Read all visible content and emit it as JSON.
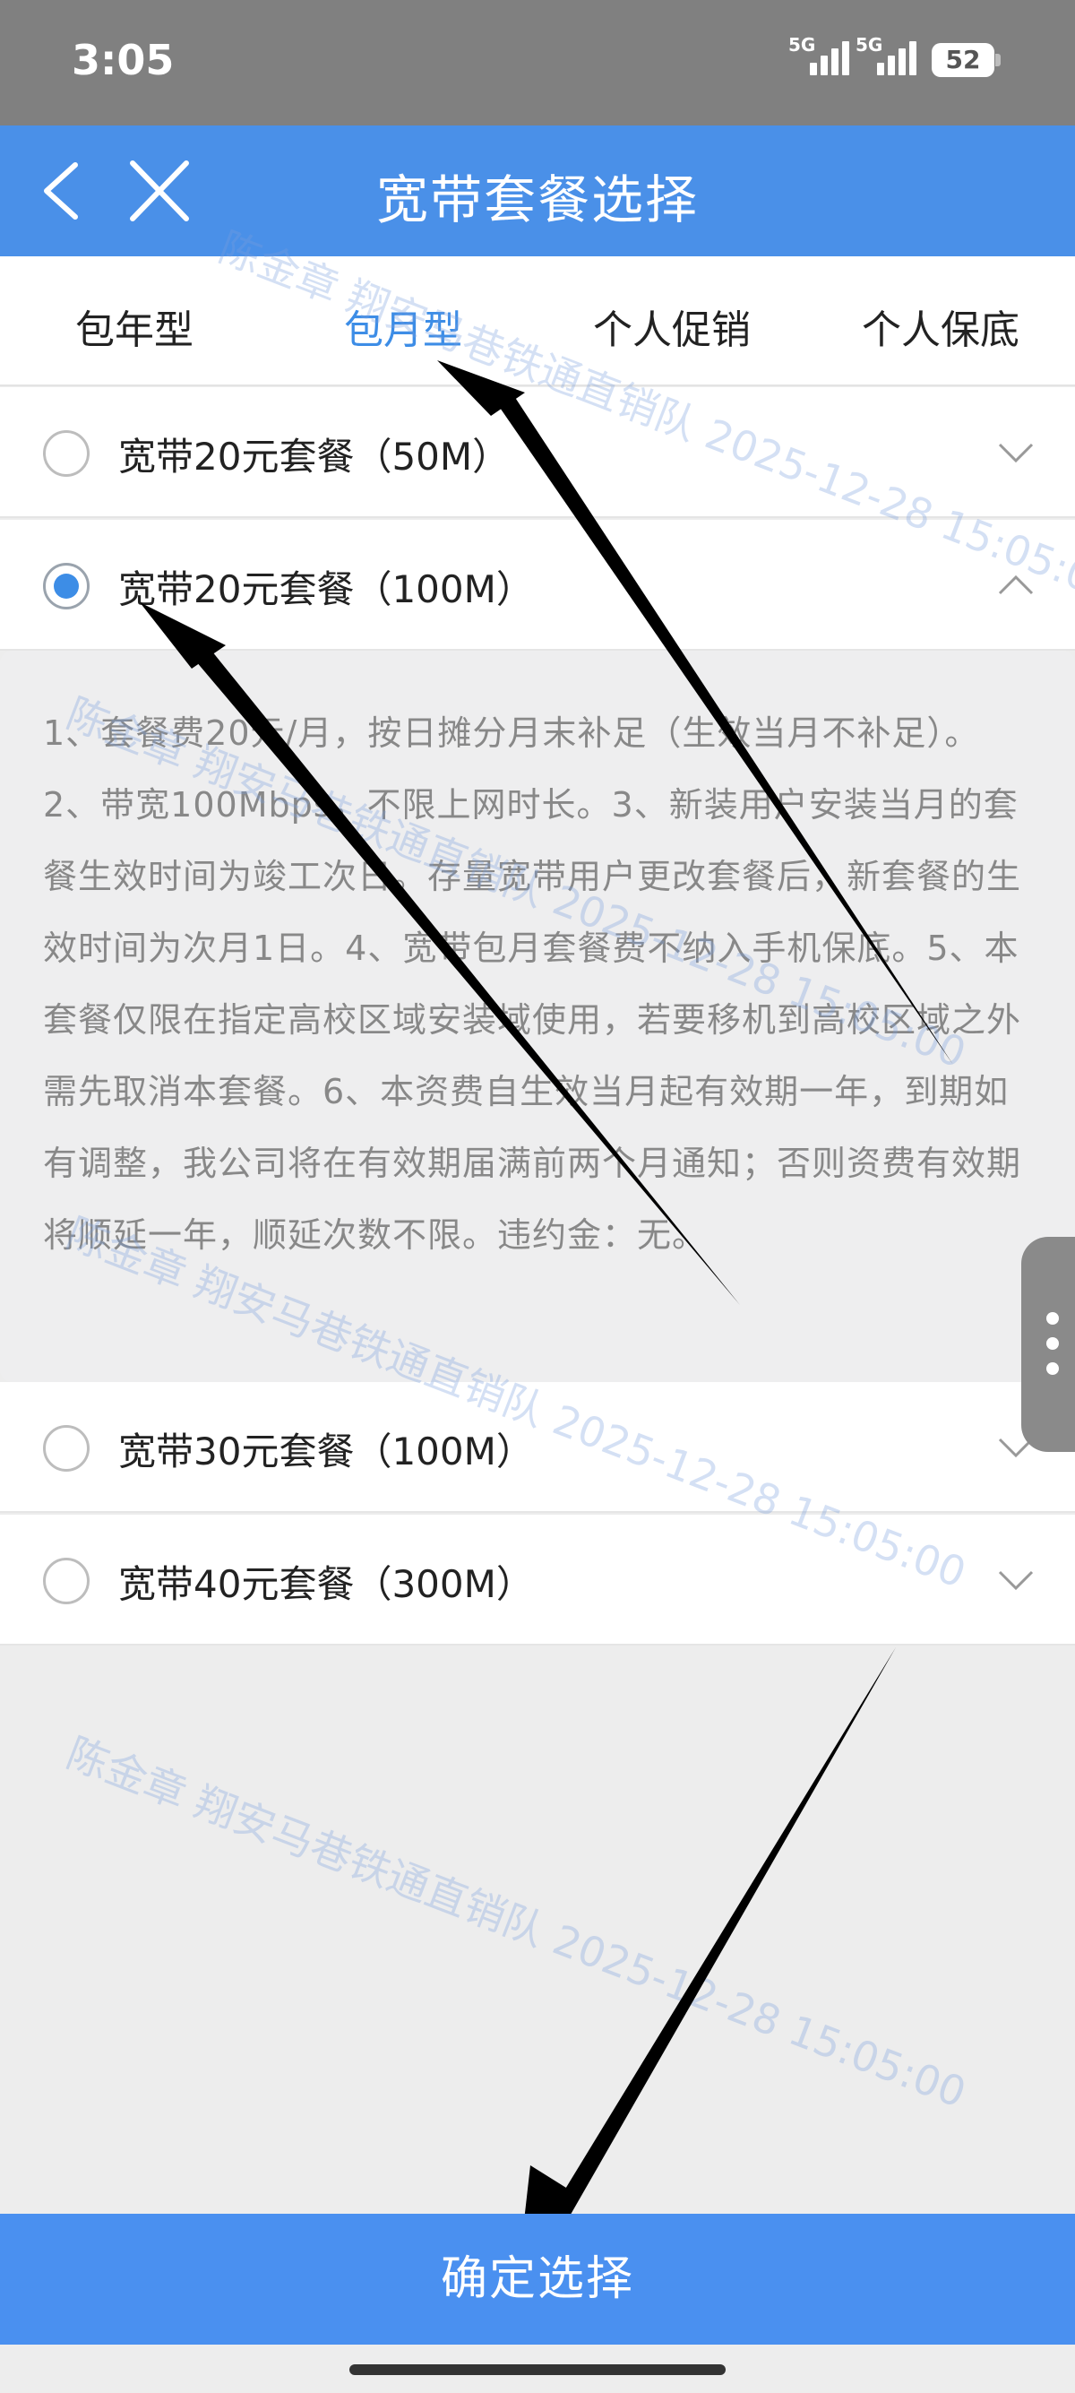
{
  "status": {
    "time": "3:05",
    "signal1": "5G",
    "signal2": "5G",
    "battery": "52"
  },
  "header": {
    "title": "宽带套餐选择"
  },
  "tabs": [
    {
      "label": "包年型",
      "active": false
    },
    {
      "label": "包月型",
      "active": true
    },
    {
      "label": "个人促销",
      "active": false
    },
    {
      "label": "个人保底",
      "active": false
    }
  ],
  "packages": [
    {
      "label": "宽带20元套餐（50M）",
      "selected": false,
      "expanded": false
    },
    {
      "label": "宽带20元套餐（100M）",
      "selected": true,
      "expanded": true
    },
    {
      "label": "宽带30元套餐（100M）",
      "selected": false,
      "expanded": false
    },
    {
      "label": "宽带40元套餐（300M）",
      "selected": false,
      "expanded": false
    }
  ],
  "detail": {
    "text": "1、套餐费20元/月，按日摊分月末补足（生效当月不补足）。2、带宽100Mbps，不限上网时长。3、新装用户安装当月的套餐生效时间为竣工次日。存量宽带用户更改套餐后，新套餐的生效时间为次月1日。4、宽带包月套餐费不纳入手机保底。5、本套餐仅限在指定高校区域安装域使用，若要移机到高校区域之外需先取消本套餐。6、本资费自生效当月起有效期一年，到期如有调整，我公司将在有效期届满前两个月通知；否则资费有效期将顺延一年，顺延次数不限。违约金：无。"
  },
  "confirm": {
    "label": "确定选择"
  },
  "watermark": {
    "text": "陈金章 翔安马巷铁通直销队 2025-12-28 15:05:00"
  },
  "colors": {
    "accent": "#4a90e8",
    "active_tab": "#3d8de6",
    "status_bar": "#808080"
  },
  "icons": {
    "back": "chevron-left-icon",
    "close": "close-icon",
    "expand": "chevron-down-icon",
    "collapse": "chevron-up-icon",
    "more": "more-vertical-icon"
  }
}
